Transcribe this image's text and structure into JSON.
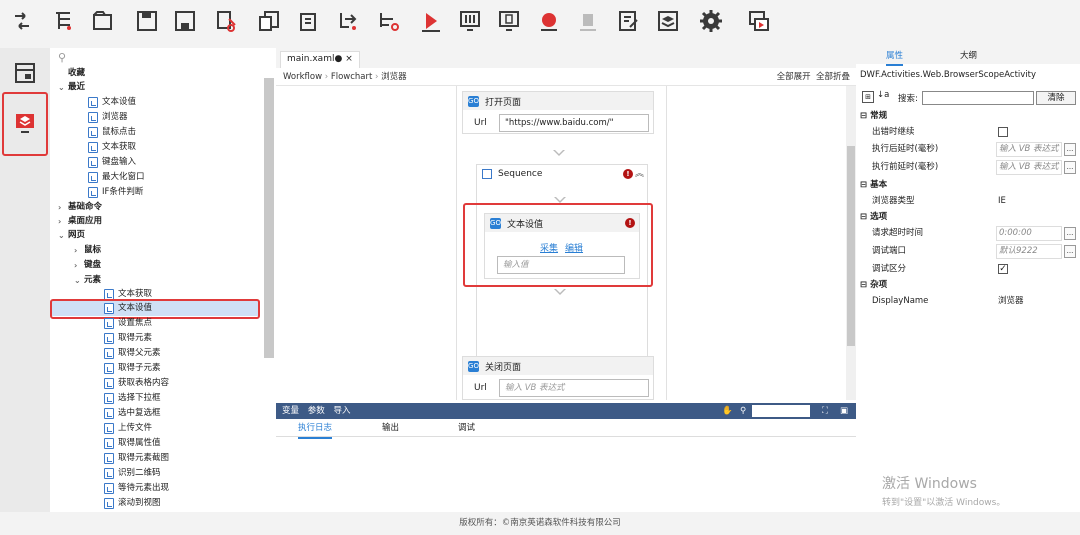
{
  "tree": {
    "items": [
      "收藏",
      "最近",
      "文本设值",
      "浏览器",
      "鼠标点击",
      "文本获取",
      "键盘输入",
      "最大化窗口",
      "IF条件判断",
      "基础命令",
      "桌面应用",
      "网页",
      "鼠标",
      "键盘",
      "元素",
      "文本获取",
      "文本设值",
      "设置焦点",
      "取得元素",
      "取得父元素",
      "取得子元素",
      "获取表格内容",
      "选择下拉框",
      "选中复选框",
      "上传文件",
      "取得属性值",
      "取得元素截图",
      "识别二维码",
      "等待元素出现",
      "滚动到视图"
    ]
  },
  "doc": {
    "tab": "main.xaml●",
    "close": "×"
  },
  "breadcrumb": {
    "items": [
      "Workflow",
      "Flowchart",
      "浏览器"
    ],
    "expand_all": "全部展开",
    "collapse_all": "全部折叠"
  },
  "designer": {
    "open_page": {
      "title": "打开页面",
      "url_label": "Url",
      "url_value": "\"https://www.baidu.com/\""
    },
    "sequence": {
      "title": "Sequence"
    },
    "set_text": {
      "title": "文本设值",
      "capture": "采集",
      "edit": "编辑",
      "placeholder": "输入值"
    },
    "close_page": {
      "title": "关闭页面",
      "url_label": "Url",
      "placeholder": "输入 VB 表达式"
    }
  },
  "bottom": {
    "tabs": [
      "变量",
      "参数",
      "导入"
    ],
    "log_tabs": [
      "执行日志",
      "输出",
      "调试"
    ]
  },
  "properties": {
    "tabs": [
      "属性",
      "大纲"
    ],
    "class_name": "DWF.Activities.Web.BrowserScopeActivity",
    "search_label": "搜索:",
    "clear_button": "清除",
    "categories": {
      "general": "常规",
      "basic": "基本",
      "options": "选项",
      "misc": "杂项"
    },
    "rows": {
      "continue_on_error": "出错时继续",
      "delay_after": "执行后延时(毫秒)",
      "delay_after_ph": "输入 VB 表达式",
      "delay_before": "执行前延时(毫秒)",
      "delay_before_ph": "输入 VB 表达式",
      "browser_type": "浏览器类型",
      "browser_type_value": "IE",
      "timeout": "请求超时时间",
      "timeout_value": "0:00:00",
      "debug_port": "调试端口",
      "debug_port_value": "默认9222",
      "debug_distinguish": "调试区分",
      "display_name": "DisplayName",
      "display_name_value": "浏览器"
    }
  },
  "watermark": {
    "line1": "激活 Windows",
    "line2": "转到\"设置\"以激活 Windows。"
  },
  "footer": {
    "text": "版权所有：©南京英诺森软件科技有限公司"
  },
  "colors": {
    "accent": "#2a7fd4",
    "highlight": "#e03a3a",
    "bottom_bar": "#3d5a86"
  }
}
